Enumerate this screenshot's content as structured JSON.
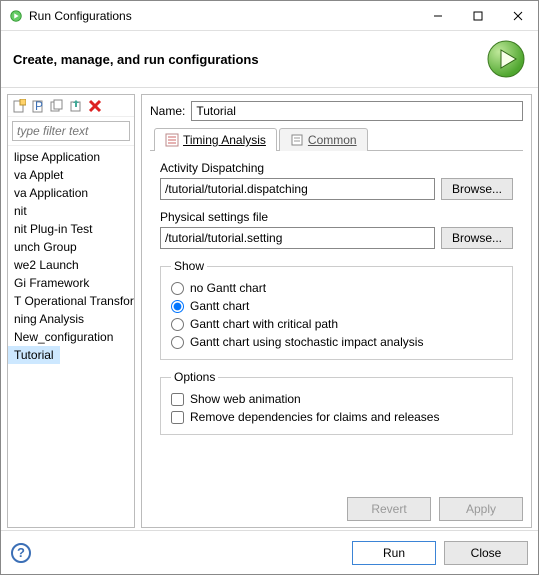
{
  "window": {
    "title": "Run Configurations"
  },
  "header": {
    "subtitle": "Create, manage, and run configurations"
  },
  "toolbar_icons": [
    "new",
    "new-prototype",
    "duplicate",
    "export",
    "delete"
  ],
  "filter": {
    "placeholder": "type filter text"
  },
  "tree": {
    "items": [
      "lipse Application",
      "va Applet",
      "va Application",
      "nit",
      "nit Plug-in Test",
      "unch Group",
      "we2 Launch",
      "Gi Framework",
      "T Operational Transfor",
      "ning Analysis",
      "New_configuration",
      "Tutorial"
    ],
    "selected_index": 11
  },
  "name": {
    "label": "Name:",
    "value": "Tutorial"
  },
  "tabs": {
    "items": [
      {
        "label": "Timing Analysis",
        "active": true
      },
      {
        "label": "Common",
        "active": false
      }
    ]
  },
  "form": {
    "activity_label": "Activity Dispatching",
    "activity_value": "/tutorial/tutorial.dispatching",
    "settings_label": "Physical settings file",
    "settings_value": "/tutorial/tutorial.setting",
    "browse_label": "Browse..."
  },
  "show_group": {
    "legend": "Show",
    "options": [
      "no Gantt chart",
      "Gantt chart",
      "Gantt chart with critical path",
      "Gantt chart using stochastic impact analysis"
    ],
    "selected_index": 1
  },
  "options_group": {
    "legend": "Options",
    "checks": [
      {
        "label": "Show web animation",
        "checked": false
      },
      {
        "label": "Remove dependencies for claims and releases",
        "checked": false
      }
    ]
  },
  "buttons": {
    "revert": "Revert",
    "apply": "Apply",
    "run": "Run",
    "close": "Close"
  }
}
